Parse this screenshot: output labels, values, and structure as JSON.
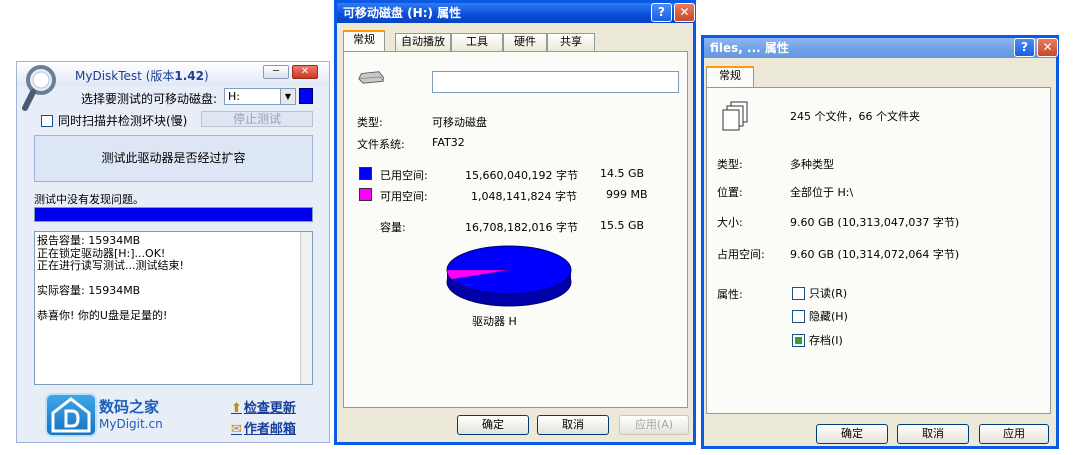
{
  "mydisktest": {
    "title_prefix": "MyDiskTest",
    "title_suffix": " (版本",
    "title_version": "1.42",
    "title_close_paren": ")",
    "min_glyph": "─",
    "close_glyph": "✕",
    "select_label": "选择要测试的可移动磁盘:",
    "drive_value": "H:",
    "dropdown_glyph": "▼",
    "swatch_color": "#0000ff",
    "scan_bad_blocks_label": "同时扫描并检测坏块(慢)",
    "stop_button": "停止测试",
    "test_button": "测试此驱动器是否经过扩容",
    "status": "测试中没有发现问题。",
    "progress_fraction": 1.0,
    "log_lines": [
      "报告容量: 15934MB",
      "正在锁定驱动器[H:]...OK!",
      "正在进行读写测试...测试结束!",
      "",
      "实际容量: 15934MB",
      "",
      "恭喜你! 你的U盘是足量的!"
    ],
    "brand_name": "数码之家",
    "brand_site": "MyDigit.cn",
    "check_update": "检查更新",
    "author_mail": "作者邮箱"
  },
  "drive_props": {
    "title": "可移动磁盘 (H:) 属性",
    "help_glyph": "?",
    "close_glyph": "✕",
    "tabs": [
      "常规",
      "自动播放",
      "工具",
      "硬件",
      "共享"
    ],
    "type_label": "类型:",
    "type_value": "可移动磁盘",
    "fs_label": "文件系统:",
    "fs_value": "FAT32",
    "used_label": "已用空间:",
    "used_bytes": "15,660,040,192 字节",
    "used_human": "14.5 GB",
    "free_label": "可用空间:",
    "free_bytes": "1,048,141,824 字节",
    "free_human": "999 MB",
    "capacity_label": "容量:",
    "capacity_bytes": "16,708,182,016 字节",
    "capacity_human": "15.5 GB",
    "drive_caption": "驱动器 H",
    "used_color": "#0000ff",
    "free_color": "#ff00ff",
    "used_fraction": 0.937,
    "ok": "确定",
    "cancel": "取消",
    "apply": "应用(A)"
  },
  "file_props": {
    "title": "files, ... 属性",
    "help_glyph": "?",
    "close_glyph": "✕",
    "tab": "常规",
    "summary": "245 个文件，66 个文件夹",
    "type_label": "类型:",
    "type_value": "多种类型",
    "location_label": "位置:",
    "location_value": "全部位于 H:\\",
    "size_label": "大小:",
    "size_value": "9.60 GB (10,313,047,037 字节)",
    "disk_size_label": "占用空间:",
    "disk_size_value": "9.60 GB (10,314,072,064 字节)",
    "attributes_label": "属性:",
    "readonly": "只读(R)",
    "hidden": "隐藏(H)",
    "archive": "存档(I)",
    "archive_checked": true,
    "ok": "确定",
    "cancel": "取消",
    "apply_partial": "应用"
  }
}
